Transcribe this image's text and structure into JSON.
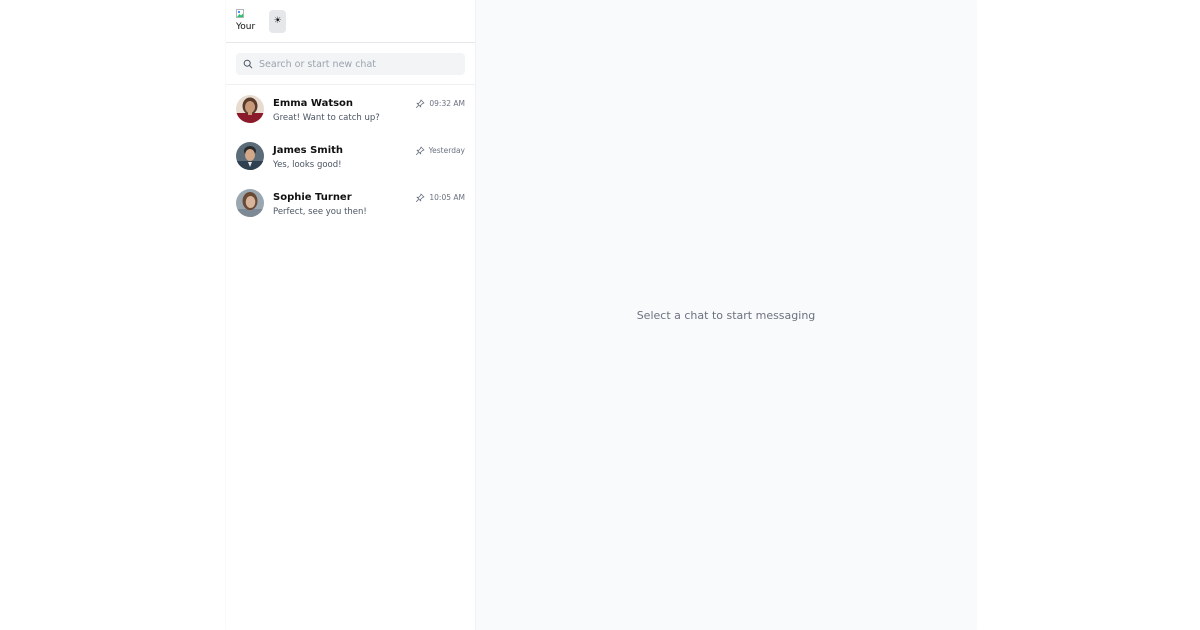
{
  "header": {
    "profile_alt": "Your",
    "theme_toggle_icon": "sun-icon",
    "theme_toggle_glyph": "☀"
  },
  "search": {
    "placeholder": "Search or start new chat"
  },
  "chats": [
    {
      "name": "Emma Watson",
      "time": "09:32 AM",
      "preview": "Great! Want to catch up?",
      "pinned": true,
      "avatar_colors": [
        "#8b1a2a",
        "#c89a7a",
        "#5a3a2a"
      ]
    },
    {
      "name": "James Smith",
      "time": "Yesterday",
      "preview": "Yes, looks good!",
      "pinned": true,
      "avatar_colors": [
        "#2f4050",
        "#d2a888",
        "#2a2a2a"
      ]
    },
    {
      "name": "Sophie Turner",
      "time": "10:05 AM",
      "preview": "Perfect, see you then!",
      "pinned": true,
      "avatar_colors": [
        "#7d8a95",
        "#d7b49a",
        "#6b4a35"
      ]
    }
  ],
  "main": {
    "empty_message": "Select a chat to start messaging"
  },
  "colors": {
    "sidebar_bg": "#ffffff",
    "main_bg": "#f9fafb",
    "search_bg": "#f3f4f6",
    "muted_text": "#6b7280"
  }
}
